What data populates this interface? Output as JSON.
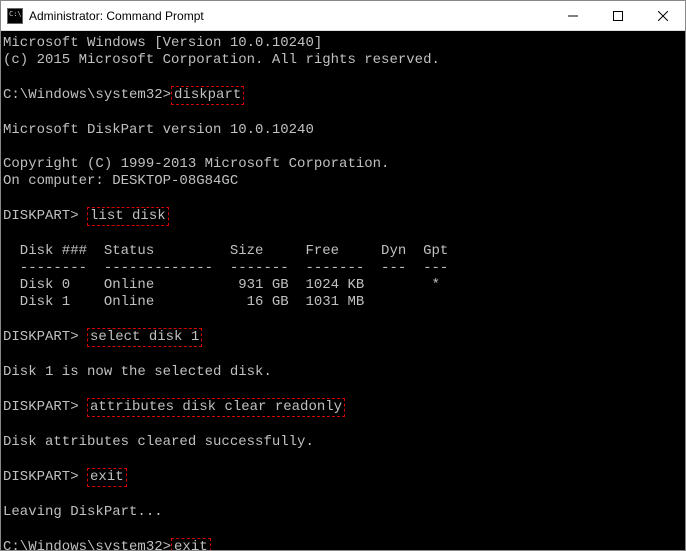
{
  "titlebar": {
    "title": "Administrator: Command Prompt"
  },
  "terminal": {
    "line1": "Microsoft Windows [Version 10.0.10240]",
    "line2": "(c) 2015 Microsoft Corporation. All rights reserved.",
    "prompt1_path": "C:\\Windows\\system32>",
    "cmd1": "diskpart",
    "dp_ver": "Microsoft DiskPart version 10.0.10240",
    "dp_copy": "Copyright (C) 1999-2013 Microsoft Corporation.",
    "dp_comp": "On computer: DESKTOP-08G84GC",
    "dp_prompt": "DISKPART> ",
    "cmd2": "list disk",
    "table_head": "  Disk ###  Status         Size     Free     Dyn  Gpt",
    "table_div": "  --------  -------------  -------  -------  ---  ---",
    "table_r1": "  Disk 0    Online          931 GB  1024 KB        *",
    "table_r2": "  Disk 1    Online           16 GB  1031 MB",
    "cmd3": "select disk 1",
    "sel_msg": "Disk 1 is now the selected disk.",
    "cmd4": "attributes disk clear readonly",
    "attr_msg": "Disk attributes cleared successfully.",
    "cmd5": "exit",
    "leaving": "Leaving DiskPart...",
    "prompt2_path": "C:\\Windows\\system32>",
    "cmd6": "exit"
  }
}
